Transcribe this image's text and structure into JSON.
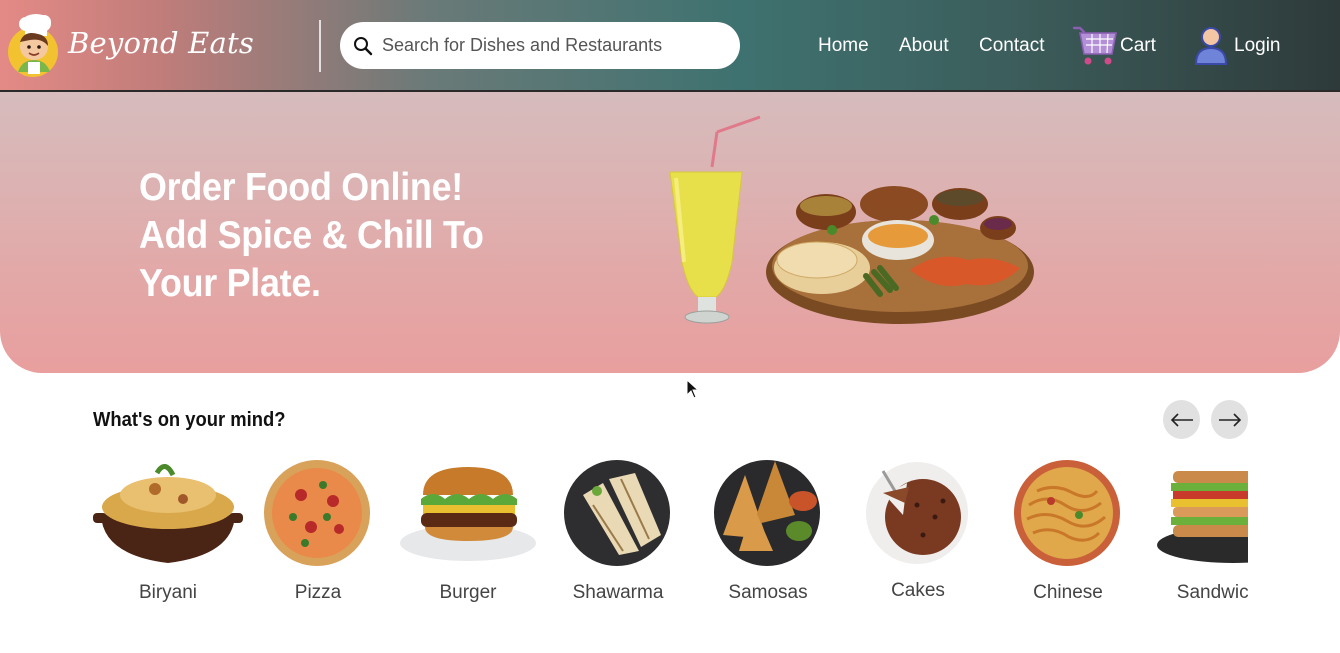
{
  "header": {
    "brand": "Beyond Eats",
    "search_placeholder": "Search for Dishes and Restaurants",
    "nav": {
      "home": "Home",
      "about": "About",
      "contact": "Contact",
      "cart": "Cart",
      "login": "Login"
    },
    "icons": {
      "search": "search-icon",
      "cart": "cart-icon",
      "user": "user-icon",
      "logo": "chef-logo-icon"
    }
  },
  "hero": {
    "lines": [
      "Order Food Online!",
      "Add Spice & Chill To",
      "Your Plate."
    ]
  },
  "mind": {
    "title": "What's on your mind?",
    "prev_icon": "arrow-left-icon",
    "next_icon": "arrow-right-icon",
    "items": [
      {
        "label": "Biryani",
        "icon": "biryani-image"
      },
      {
        "label": "Pizza",
        "icon": "pizza-image"
      },
      {
        "label": "Burger",
        "icon": "burger-image"
      },
      {
        "label": "Shawarma",
        "icon": "shawarma-image"
      },
      {
        "label": "Samosas",
        "icon": "samosas-image"
      },
      {
        "label": "Cakes",
        "icon": "cakes-image"
      },
      {
        "label": "Chinese",
        "icon": "chinese-image"
      },
      {
        "label": "Sandwich",
        "icon": "sandwich-image"
      }
    ]
  },
  "colors": {
    "header_start": "#e48a86",
    "header_end": "#2e3a3a",
    "hero_bottom": "#e89f9e",
    "text_white": "#ffffff"
  }
}
